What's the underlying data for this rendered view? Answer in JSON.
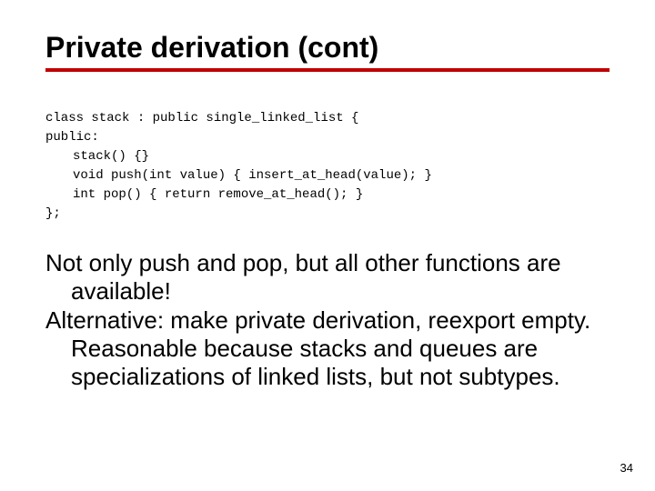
{
  "title": "Private derivation (cont)",
  "code": {
    "l1": "class stack : public single_linked_list {",
    "l2": "public:",
    "l3": "stack() {}",
    "l4": "void push(int value) { insert_at_head(value); }",
    "l5": "int pop() { return remove_at_head(); }",
    "l6": "};"
  },
  "body": {
    "p1": "Not only push and pop, but all other functions are available!",
    "p2": "Alternative: make private derivation, reexport empty.  Reasonable because stacks and queues are specializations of linked lists, but not subtypes."
  },
  "page_number": "34"
}
